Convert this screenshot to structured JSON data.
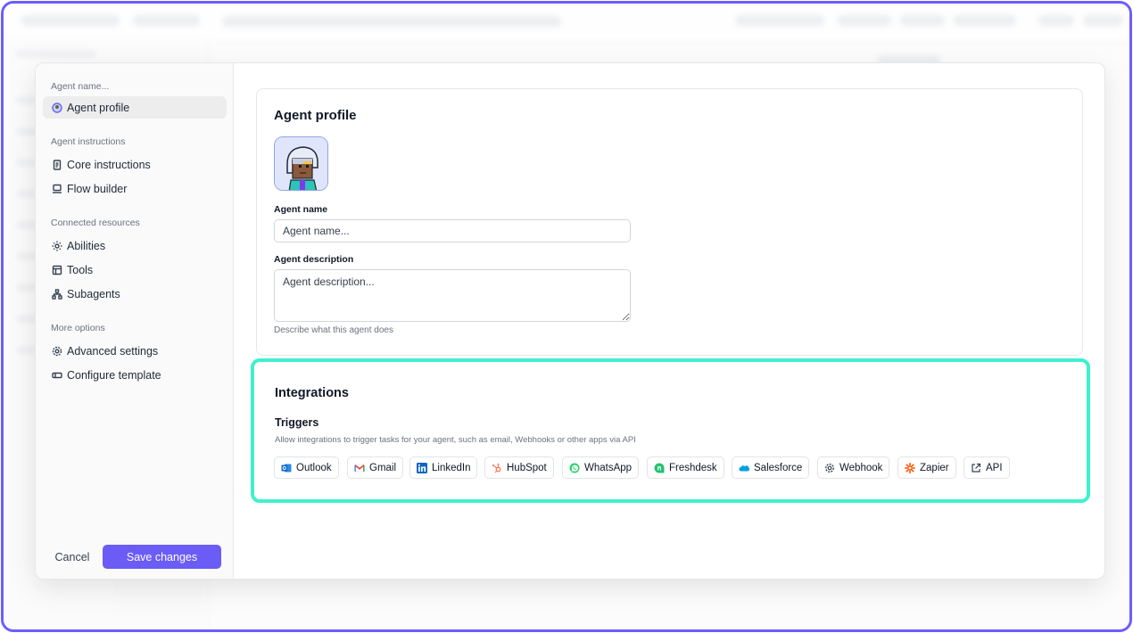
{
  "sidebar": {
    "header": "Agent name...",
    "active_item": "Agent profile",
    "sections": [
      {
        "title": "Agent instructions",
        "items": [
          "Core instructions",
          "Flow builder"
        ]
      },
      {
        "title": "Connected resources",
        "items": [
          "Abilities",
          "Tools",
          "Subagents"
        ]
      },
      {
        "title": "More options",
        "items": [
          "Advanced settings",
          "Configure template"
        ]
      }
    ],
    "cancel_label": "Cancel",
    "save_label": "Save changes"
  },
  "profile": {
    "title": "Agent profile",
    "name_label": "Agent name",
    "name_placeholder": "Agent name...",
    "description_label": "Agent description",
    "description_placeholder": "Agent description...",
    "description_help": "Describe what this agent does"
  },
  "integrations": {
    "title": "Integrations",
    "triggers_title": "Triggers",
    "triggers_desc": "Allow integrations to trigger tasks for your agent, such as email, Webhooks or other apps via API",
    "chips": [
      {
        "label": "Outlook",
        "icon": "outlook-icon",
        "color": "#0a64c8"
      },
      {
        "label": "Gmail",
        "icon": "gmail-icon",
        "color": "#ea4335"
      },
      {
        "label": "LinkedIn",
        "icon": "linkedin-icon",
        "color": "#0a66c2"
      },
      {
        "label": "HubSpot",
        "icon": "hubspot-icon",
        "color": "#ff7a59"
      },
      {
        "label": "WhatsApp",
        "icon": "whatsapp-icon",
        "color": "#25d366"
      },
      {
        "label": "Freshdesk",
        "icon": "freshdesk-icon",
        "color": "#25c16f"
      },
      {
        "label": "Salesforce",
        "icon": "salesforce-icon",
        "color": "#00a1e0"
      },
      {
        "label": "Webhook",
        "icon": "gear-icon",
        "color": "#374151"
      },
      {
        "label": "Zapier",
        "icon": "zapier-icon",
        "color": "#ff4f00"
      },
      {
        "label": "API",
        "icon": "external-link-icon",
        "color": "#374151"
      }
    ]
  },
  "colors": {
    "accent": "#6b5cf6",
    "highlight": "#40f0cf",
    "frame": "#6d5dfc"
  }
}
